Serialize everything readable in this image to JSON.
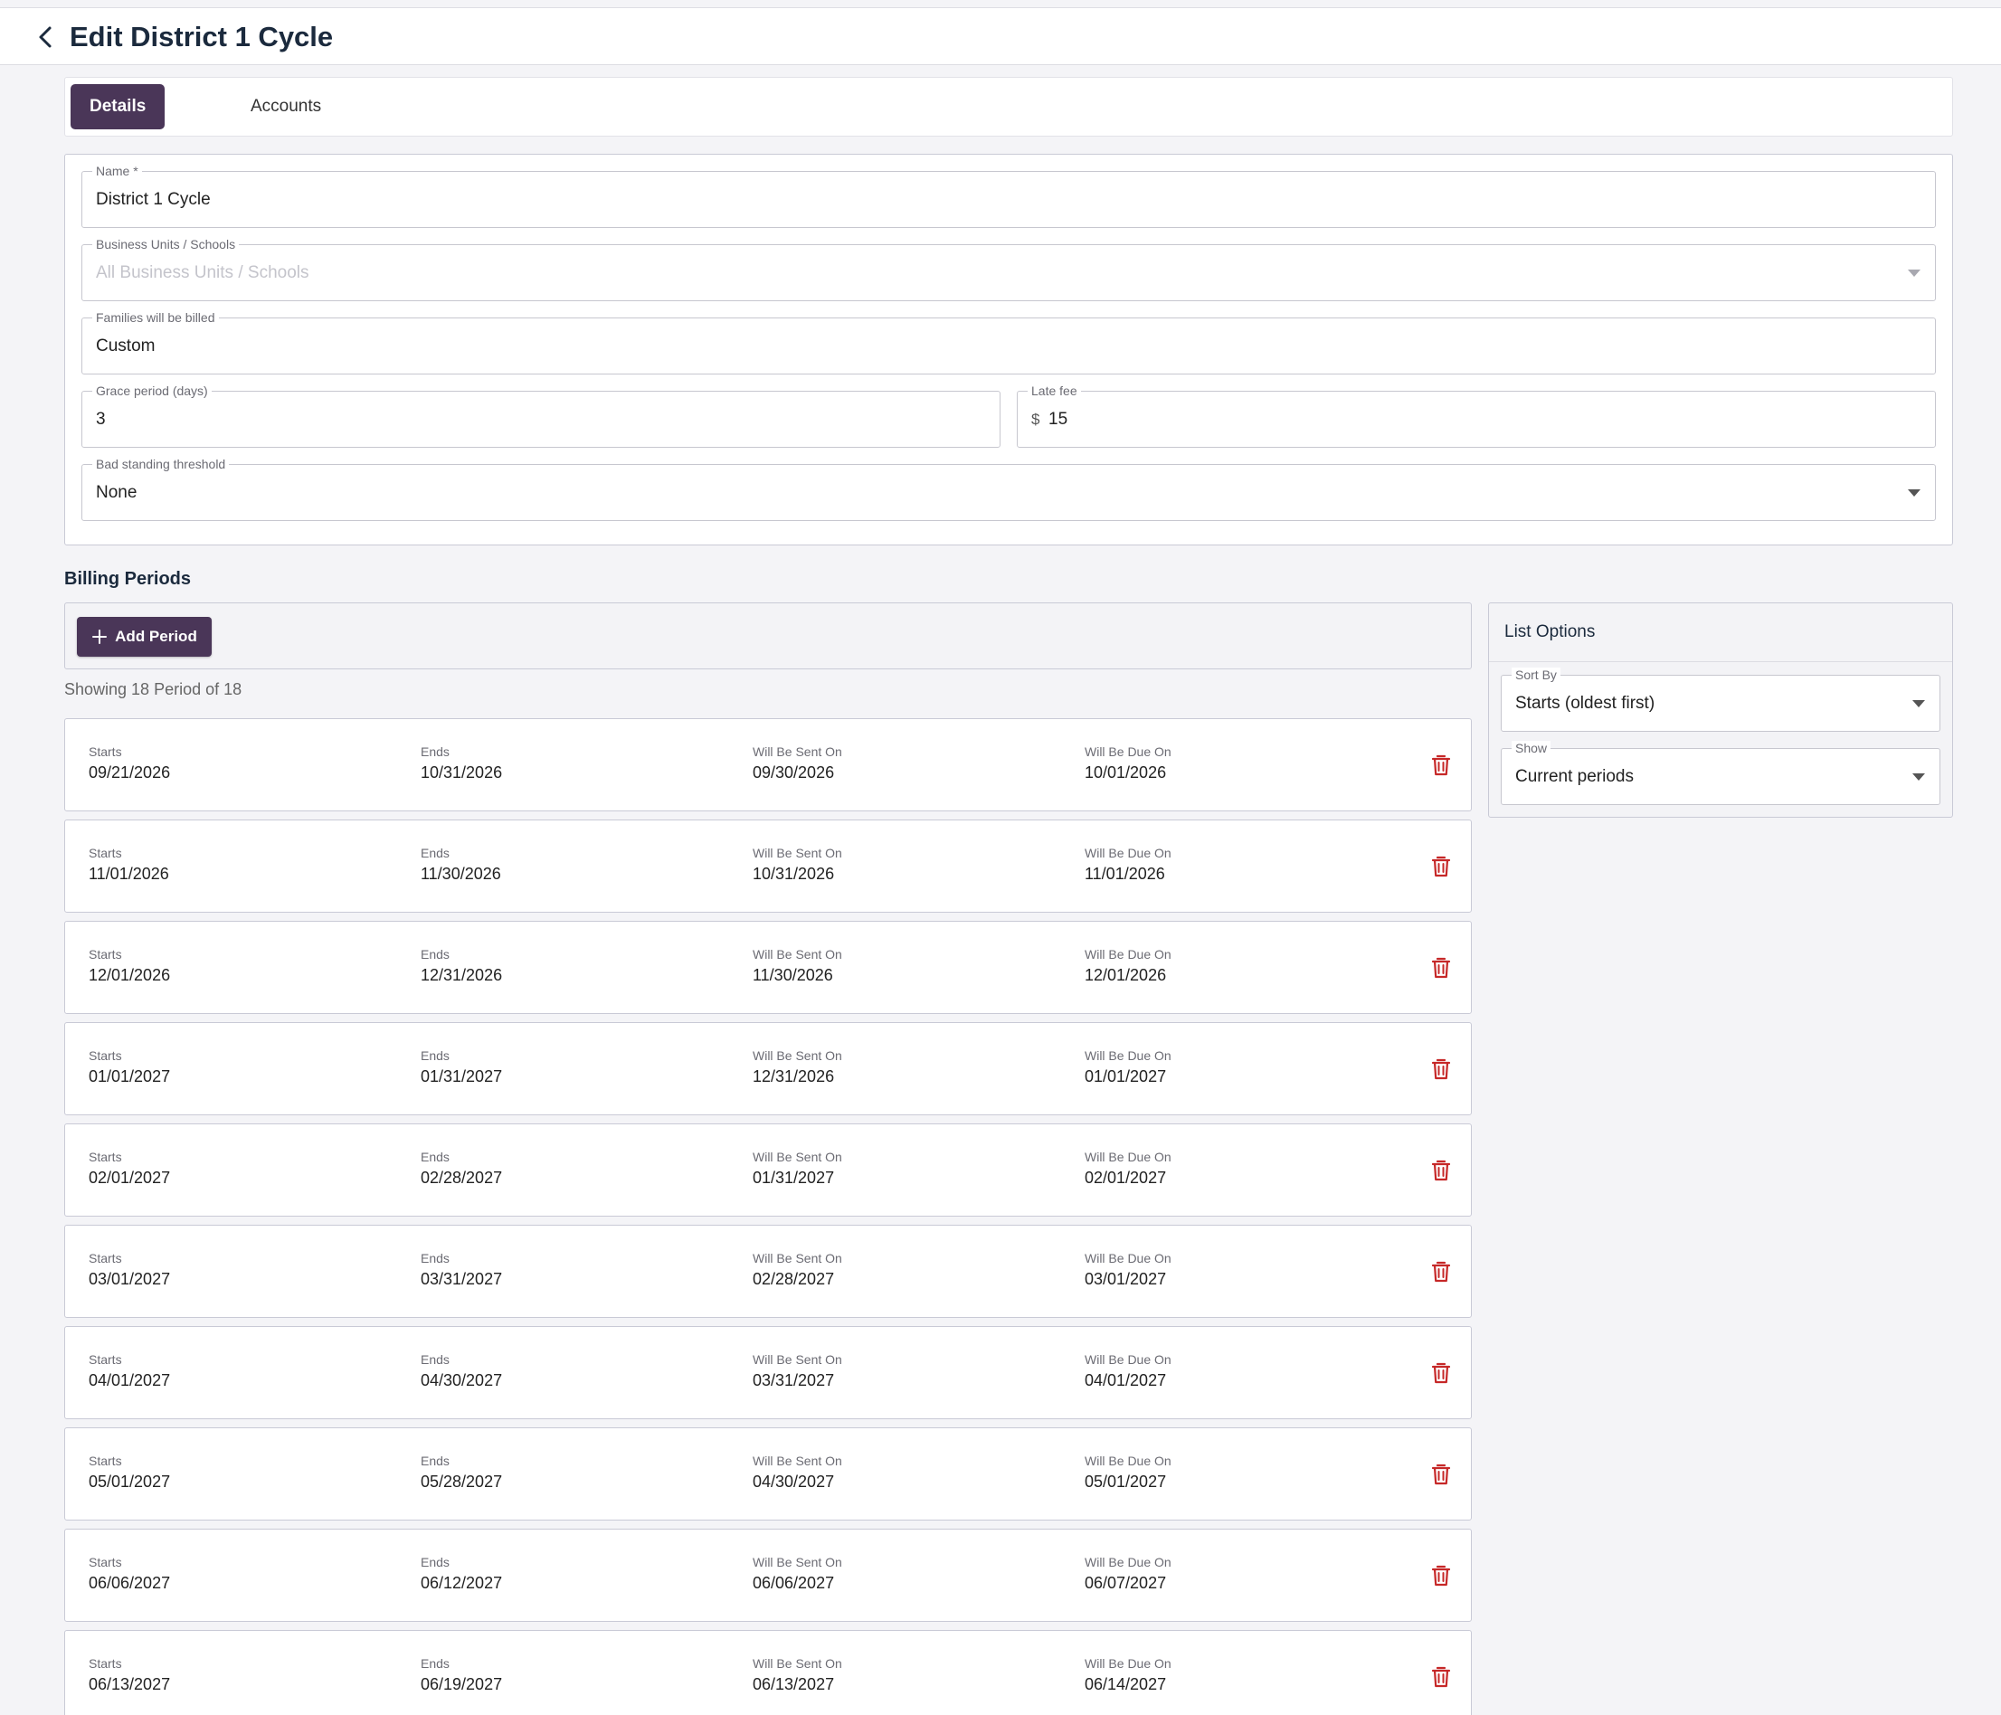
{
  "header": {
    "title": "Edit District 1 Cycle"
  },
  "tabs": [
    {
      "label": "Details",
      "active": true
    },
    {
      "label": "Accounts",
      "active": false
    }
  ],
  "form": {
    "name": {
      "label": "Name *",
      "value": "District 1 Cycle"
    },
    "business_units": {
      "label": "Business Units / Schools",
      "placeholder": "All Business Units / Schools"
    },
    "billing": {
      "label": "Families will be billed",
      "value": "Custom"
    },
    "grace": {
      "label": "Grace period (days)",
      "value": "3"
    },
    "late_fee": {
      "label": "Late fee",
      "prefix": "$",
      "value": "15"
    },
    "threshold": {
      "label": "Bad standing threshold",
      "value": "None"
    }
  },
  "billing_periods": {
    "title": "Billing Periods",
    "add_label": "Add Period",
    "showing": "Showing 18 Period of 18",
    "column_labels": [
      "Starts",
      "Ends",
      "Will Be Sent On",
      "Will Be Due On"
    ],
    "rows": [
      [
        "09/21/2026",
        "10/31/2026",
        "09/30/2026",
        "10/01/2026"
      ],
      [
        "11/01/2026",
        "11/30/2026",
        "10/31/2026",
        "11/01/2026"
      ],
      [
        "12/01/2026",
        "12/31/2026",
        "11/30/2026",
        "12/01/2026"
      ],
      [
        "01/01/2027",
        "01/31/2027",
        "12/31/2026",
        "01/01/2027"
      ],
      [
        "02/01/2027",
        "02/28/2027",
        "01/31/2027",
        "02/01/2027"
      ],
      [
        "03/01/2027",
        "03/31/2027",
        "02/28/2027",
        "03/01/2027"
      ],
      [
        "04/01/2027",
        "04/30/2027",
        "03/31/2027",
        "04/01/2027"
      ],
      [
        "05/01/2027",
        "05/28/2027",
        "04/30/2027",
        "05/01/2027"
      ],
      [
        "06/06/2027",
        "06/12/2027",
        "06/06/2027",
        "06/07/2027"
      ],
      [
        "06/13/2027",
        "06/19/2027",
        "06/13/2027",
        "06/14/2027"
      ]
    ]
  },
  "list_options": {
    "title": "List Options",
    "sort_by": {
      "label": "Sort By",
      "value": "Starts (oldest first)"
    },
    "show": {
      "label": "Show",
      "value": "Current periods"
    }
  },
  "colors": {
    "accent": "#4a3658",
    "delete": "#c62828",
    "border": "#c9cad6"
  },
  "icons": {
    "back": "chevron-left-icon",
    "add": "plus-icon",
    "delete": "trash-icon",
    "dropdown": "caret-down-icon"
  }
}
